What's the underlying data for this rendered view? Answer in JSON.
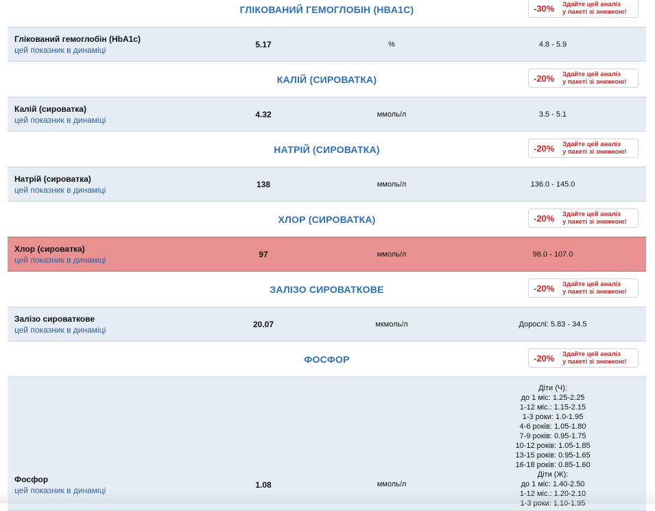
{
  "sections": [
    {
      "title": "ГЛІКОВАНИЙ ГЕМОГЛОБІН (HBA1C)",
      "promo": {
        "percent": "-30%",
        "line1": "Здайте цей аналіз",
        "line2": "у пакеті зі знижкою!"
      },
      "row": {
        "name": "Глікований гемоглобін (HbA1c)",
        "link": "цей показник в динаміці",
        "value": "5.17",
        "unit": "%",
        "ref": "4.8 - 5.9",
        "abnormal": false
      }
    },
    {
      "title": "КАЛІЙ (СИРОВАТКА)",
      "promo": {
        "percent": "-20%",
        "line1": "Здайте цей аналіз",
        "line2": "у пакеті зі знижкою!"
      },
      "row": {
        "name": "Калій (сироватка)",
        "link": "цей показник в динаміці",
        "value": "4.32",
        "unit": "ммоль/л",
        "ref": "3.5 - 5.1",
        "abnormal": false
      }
    },
    {
      "title": "НАТРІЙ (СИРОВАТКА)",
      "promo": {
        "percent": "-20%",
        "line1": "Здайте цей аналіз",
        "line2": "у пакеті зі знижкою!"
      },
      "row": {
        "name": "Натрій (сироватка)",
        "link": "цей показник в динаміці",
        "value": "138",
        "unit": "ммоль/л",
        "ref": "136.0 - 145.0",
        "abnormal": false
      }
    },
    {
      "title": "ХЛОР (СИРОВАТКА)",
      "promo": {
        "percent": "-20%",
        "line1": "Здайте цей аналіз",
        "line2": "у пакеті зі знижкою!"
      },
      "row": {
        "name": "Хлор (сироватка)",
        "link": "цей показник в динаміці",
        "value": "97",
        "unit": "ммоль/л",
        "ref": "98.0 - 107.0",
        "abnormal": true
      }
    },
    {
      "title": "ЗАЛІЗО СИРОВАТКОВЕ",
      "promo": {
        "percent": "-20%",
        "line1": "Здайте цей аналіз",
        "line2": "у пакеті зі знижкою!"
      },
      "row": {
        "name": "Залізо сироваткове",
        "link": "цей показник в динаміці",
        "value": "20.07",
        "unit": "мкмоль/л",
        "ref": "Дорослі: 5.83 - 34.5",
        "abnormal": false
      }
    },
    {
      "title": "ФОСФОР",
      "promo": {
        "percent": "-20%",
        "line1": "Здайте цей аналіз",
        "line2": "у пакеті зі знижкою!"
      },
      "row": {
        "name": "Фосфор",
        "link": "цей показник в динаміці",
        "value": "1.08",
        "unit": "ммоль/л",
        "abnormal": false,
        "ref_lines": [
          "Діти (Ч):",
          "до 1 міс: 1.25-2.25",
          "1-12 міс.: 1.15-2.15",
          "1-3 роки: 1.0-1.95",
          "4-6 років: 1.05-1.80",
          "7-9 років: 0.95-1.75",
          "10-12 років: 1.05-1.85",
          "13-15 років: 0.95-1.65",
          "16-18 років: 0.85-1.60",
          "Діти (Ж):",
          "до 1 міс: 1.40-2.50",
          "1-12 міс.: 1.20-2.10",
          "1-3 роки: 1.10-1.95"
        ]
      }
    }
  ]
}
